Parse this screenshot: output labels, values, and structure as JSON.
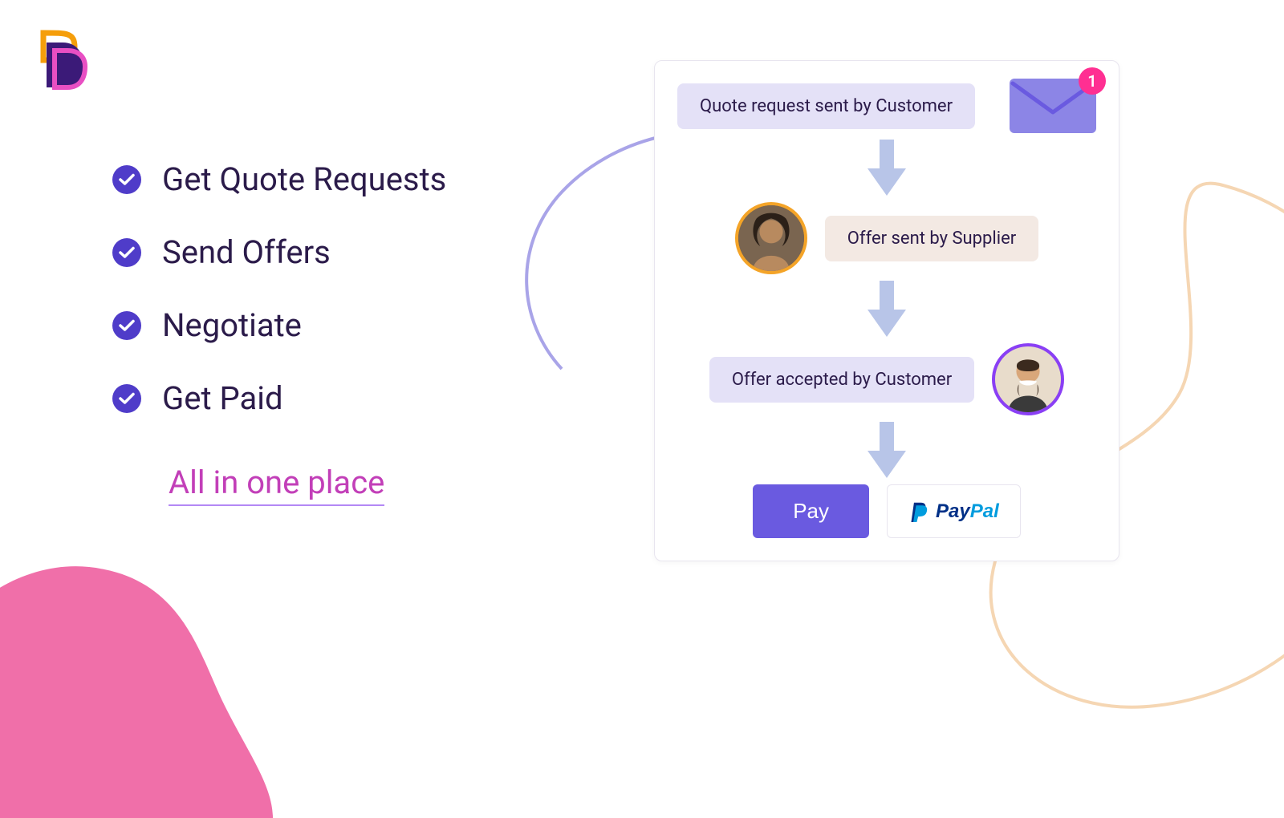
{
  "features": [
    {
      "label": "Get Quote Requests"
    },
    {
      "label": "Send Offers"
    },
    {
      "label": "Negotiate"
    },
    {
      "label": "Get Paid"
    }
  ],
  "tagline": "All in one place",
  "flow": {
    "step1": "Quote request sent by Customer",
    "step2": "Offer sent by Supplier",
    "step3": "Offer accepted by Customer",
    "envelope_badge": "1",
    "pay_label": "Pay",
    "paypal_a": "Pay",
    "paypal_b": "Pal"
  },
  "colors": {
    "accent_purple": "#6a5ae0",
    "accent_pink": "#ff2f92",
    "tagline": "#c23fb8"
  }
}
